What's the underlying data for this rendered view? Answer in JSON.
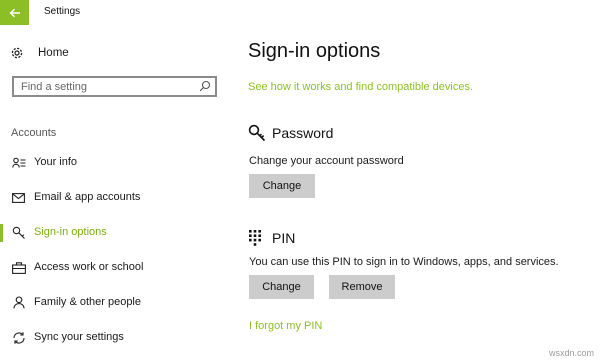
{
  "window": {
    "title": "Settings",
    "accent": "#8cbf26"
  },
  "sidebar": {
    "home_label": "Home",
    "search": {
      "placeholder": "Find a setting"
    },
    "section_label": "Accounts",
    "items": [
      {
        "label": "Your info",
        "icon": "person-list-icon"
      },
      {
        "label": "Email & app accounts",
        "icon": "mail-icon"
      },
      {
        "label": "Sign-in options",
        "icon": "key-icon",
        "active": true
      },
      {
        "label": "Access work or school",
        "icon": "briefcase-icon"
      },
      {
        "label": "Family & other people",
        "icon": "person-icon"
      },
      {
        "label": "Sync your settings",
        "icon": "sync-icon"
      }
    ]
  },
  "main": {
    "title": "Sign-in options",
    "compat_link": "See how it works and find compatible devices.",
    "password": {
      "heading": "Password",
      "description": "Change your account password",
      "change_label": "Change"
    },
    "pin": {
      "heading": "PIN",
      "description": "You can use this PIN to sign in to Windows, apps, and services.",
      "change_label": "Change",
      "remove_label": "Remove",
      "forgot_link": "I forgot my PIN"
    }
  },
  "watermark": "wsxdn.com"
}
